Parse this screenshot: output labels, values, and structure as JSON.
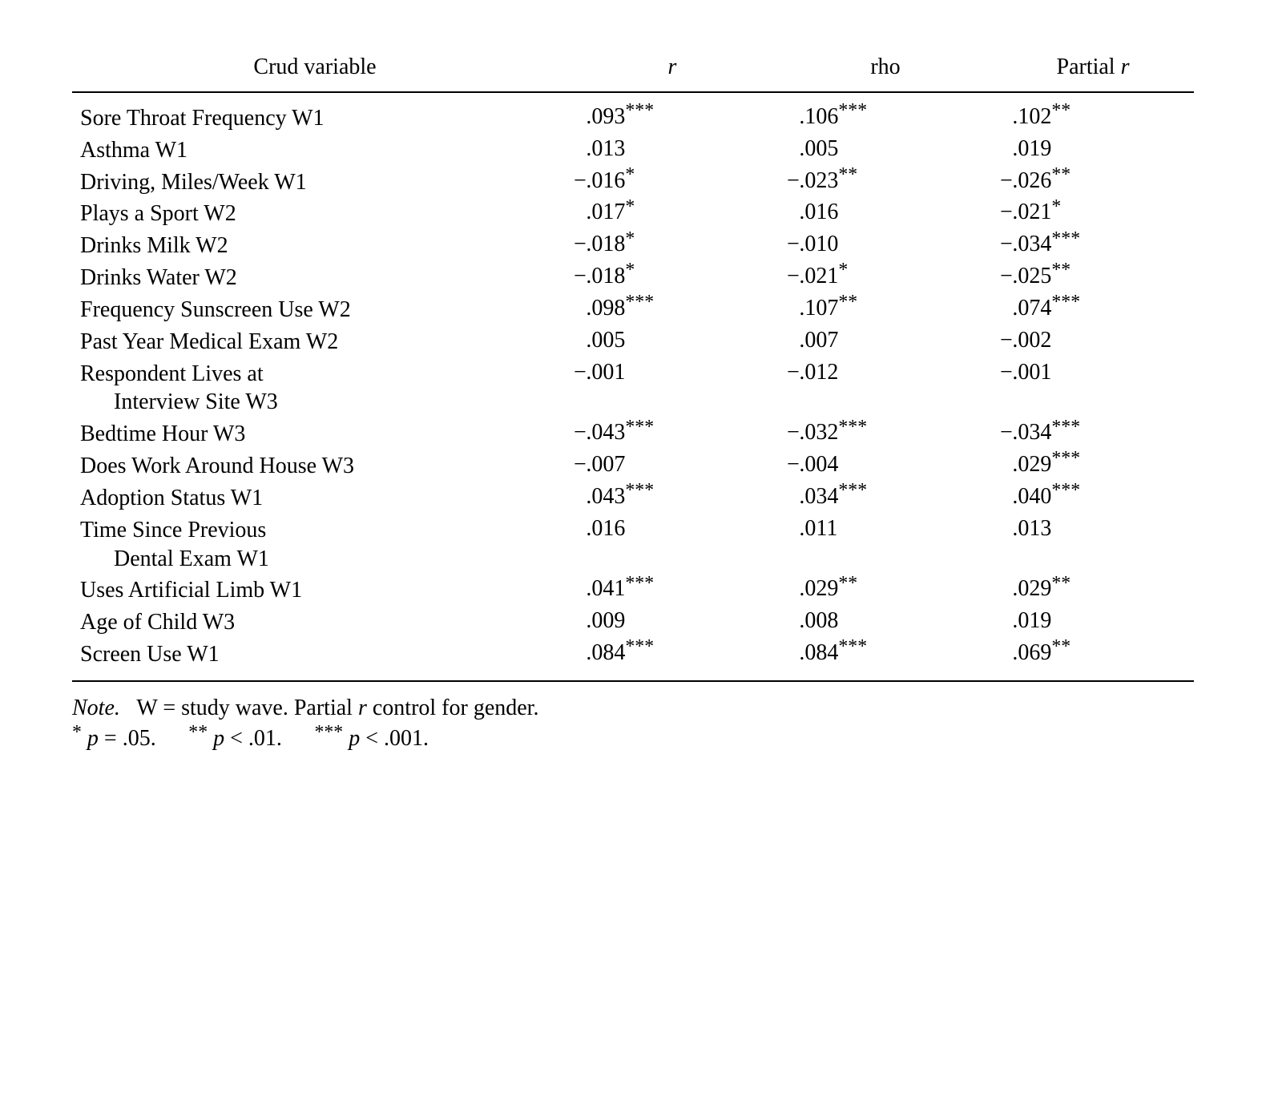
{
  "headers": {
    "var": "Crud variable",
    "r": "r",
    "rho": "rho",
    "partial": "Partial r"
  },
  "rows": [
    {
      "var": "Sore Throat Frequency W1",
      "indent": "",
      "r": ".093",
      "r_sig": "***",
      "rho": ".106",
      "rho_sig": "***",
      "p": ".102",
      "p_sig": "**",
      "r_neg": false,
      "rho_neg": false,
      "p_neg": false
    },
    {
      "var": "Asthma W1",
      "indent": "",
      "r": ".013",
      "r_sig": "",
      "rho": ".005",
      "rho_sig": "",
      "p": ".019",
      "p_sig": "",
      "r_neg": false,
      "rho_neg": false,
      "p_neg": false
    },
    {
      "var": "Driving, Miles/Week W1",
      "indent": "",
      "r": ".016",
      "r_sig": "*",
      "rho": ".023",
      "rho_sig": "**",
      "p": ".026",
      "p_sig": "**",
      "r_neg": true,
      "rho_neg": true,
      "p_neg": true
    },
    {
      "var": "Plays a Sport W2",
      "indent": "",
      "r": ".017",
      "r_sig": "*",
      "rho": ".016",
      "rho_sig": "",
      "p": ".021",
      "p_sig": "*",
      "r_neg": false,
      "rho_neg": false,
      "p_neg": true
    },
    {
      "var": "Drinks Milk W2",
      "indent": "",
      "r": ".018",
      "r_sig": "*",
      "rho": ".010",
      "rho_sig": "",
      "p": ".034",
      "p_sig": "***",
      "r_neg": true,
      "rho_neg": true,
      "p_neg": true
    },
    {
      "var": "Drinks Water W2",
      "indent": "",
      "r": ".018",
      "r_sig": "*",
      "rho": ".021",
      "rho_sig": "*",
      "p": ".025",
      "p_sig": "**",
      "r_neg": true,
      "rho_neg": true,
      "p_neg": true
    },
    {
      "var": "Frequency Sunscreen Use W2",
      "indent": "",
      "r": ".098",
      "r_sig": "***",
      "rho": ".107",
      "rho_sig": "**",
      "p": ".074",
      "p_sig": "***",
      "r_neg": false,
      "rho_neg": false,
      "p_neg": false
    },
    {
      "var": "Past Year Medical Exam W2",
      "indent": "",
      "r": ".005",
      "r_sig": "",
      "rho": ".007",
      "rho_sig": "",
      "p": ".002",
      "p_sig": "",
      "r_neg": false,
      "rho_neg": false,
      "p_neg": true
    },
    {
      "var": "Respondent Lives at",
      "indent": "Interview Site W3",
      "r": ".001",
      "r_sig": "",
      "rho": ".012",
      "rho_sig": "",
      "p": ".001",
      "p_sig": "",
      "r_neg": true,
      "rho_neg": true,
      "p_neg": true
    },
    {
      "var": "Bedtime Hour W3",
      "indent": "",
      "r": ".043",
      "r_sig": "***",
      "rho": ".032",
      "rho_sig": "***",
      "p": ".034",
      "p_sig": "***",
      "r_neg": true,
      "rho_neg": true,
      "p_neg": true
    },
    {
      "var": "Does Work Around House W3",
      "indent": "",
      "r": ".007",
      "r_sig": "",
      "rho": ".004",
      "rho_sig": "",
      "p": ".029",
      "p_sig": "***",
      "r_neg": true,
      "rho_neg": true,
      "p_neg": false
    },
    {
      "var": "Adoption Status W1",
      "indent": "",
      "r": ".043",
      "r_sig": "***",
      "rho": ".034",
      "rho_sig": "***",
      "p": ".040",
      "p_sig": "***",
      "r_neg": false,
      "rho_neg": false,
      "p_neg": false
    },
    {
      "var": "Time Since Previous",
      "indent": "Dental Exam W1",
      "r": ".016",
      "r_sig": "",
      "rho": ".011",
      "rho_sig": "",
      "p": ".013",
      "p_sig": "",
      "r_neg": false,
      "rho_neg": false,
      "p_neg": false
    },
    {
      "var": "Uses Artificial Limb W1",
      "indent": "",
      "r": ".041",
      "r_sig": "***",
      "rho": ".029",
      "rho_sig": "**",
      "p": ".029",
      "p_sig": "**",
      "r_neg": false,
      "rho_neg": false,
      "p_neg": false
    },
    {
      "var": "Age of Child W3",
      "indent": "",
      "r": ".009",
      "r_sig": "",
      "rho": ".008",
      "rho_sig": "",
      "p": ".019",
      "p_sig": "",
      "r_neg": false,
      "rho_neg": false,
      "p_neg": false
    },
    {
      "var": "Screen Use W1",
      "indent": "",
      "r": ".084",
      "r_sig": "***",
      "rho": ".084",
      "rho_sig": "***",
      "p": ".069",
      "p_sig": "**",
      "r_neg": false,
      "rho_neg": false,
      "p_neg": false
    }
  ],
  "note": {
    "label": "Note.",
    "text1": "W = study wave. Partial ",
    "text2": " control for gender.",
    "r_italic": "r",
    "sig1_mark": "*",
    "sig1_text": " = .05.",
    "sig1_p": "p",
    "sig2_mark": "**",
    "sig2_text": " < .01.",
    "sig2_p": "p",
    "sig3_mark": "***",
    "sig3_text": " < .001.",
    "sig3_p": "p"
  },
  "chart_data": {
    "type": "table",
    "title": "Correlations between Crud variables and outcome",
    "columns": [
      "Crud variable",
      "r",
      "rho",
      "Partial r"
    ],
    "rows": [
      [
        "Sore Throat Frequency W1",
        0.093,
        0.106,
        0.102
      ],
      [
        "Asthma W1",
        0.013,
        0.005,
        0.019
      ],
      [
        "Driving, Miles/Week W1",
        -0.016,
        -0.023,
        -0.026
      ],
      [
        "Plays a Sport W2",
        0.017,
        0.016,
        -0.021
      ],
      [
        "Drinks Milk W2",
        -0.018,
        -0.01,
        -0.034
      ],
      [
        "Drinks Water W2",
        -0.018,
        -0.021,
        -0.025
      ],
      [
        "Frequency Sunscreen Use W2",
        0.098,
        0.107,
        0.074
      ],
      [
        "Past Year Medical Exam W2",
        0.005,
        0.007,
        -0.002
      ],
      [
        "Respondent Lives at Interview Site W3",
        -0.001,
        -0.012,
        -0.001
      ],
      [
        "Bedtime Hour W3",
        -0.043,
        -0.032,
        -0.034
      ],
      [
        "Does Work Around House W3",
        -0.007,
        -0.004,
        0.029
      ],
      [
        "Adoption Status W1",
        0.043,
        0.034,
        0.04
      ],
      [
        "Time Since Previous Dental Exam W1",
        0.016,
        0.011,
        0.013
      ],
      [
        "Uses Artificial Limb W1",
        0.041,
        0.029,
        0.029
      ],
      [
        "Age of Child W3",
        0.009,
        0.008,
        0.019
      ],
      [
        "Screen Use W1",
        0.084,
        0.084,
        0.069
      ]
    ],
    "note": "W = study wave. Partial r control for gender. * p = .05, ** p < .01, *** p < .001."
  }
}
